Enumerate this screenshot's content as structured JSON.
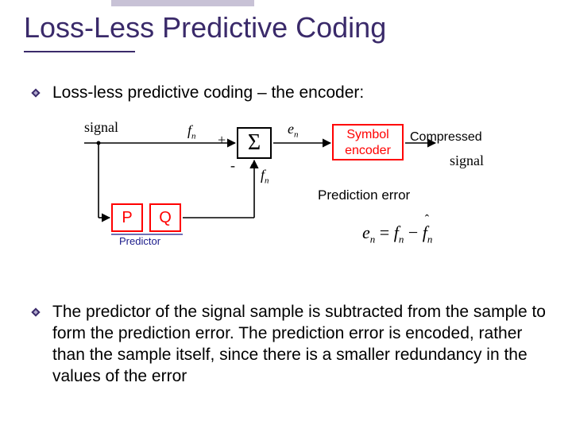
{
  "title": "Loss-Less Predictive Coding",
  "bullets": {
    "first": "Loss-less predictive coding – the encoder:",
    "second": "The predictor of the signal sample is subtracted from the sample to form the prediction error. The prediction error is encoded, rather than the sample itself, since there is a smaller redundancy in the values of the error"
  },
  "diagram": {
    "signal_in": "signal",
    "signal_out": "signal",
    "fn": "f",
    "fn_sub": "n",
    "en": "e",
    "en_sub": "n",
    "fhat": "f",
    "fhat_sub": "n",
    "sigma": "Σ",
    "plus": "+",
    "minus": "-",
    "symbol_encoder_l1": "Symbol",
    "symbol_encoder_l2": "encoder",
    "compressed": "Compressed",
    "p": "P",
    "q": "Q",
    "predictor": "Predictor",
    "prediction_error": "Prediction error",
    "eq_e": "e",
    "eq_e_sub": "n",
    "eq_equals": " = ",
    "eq_f": "f",
    "eq_f_sub": "n",
    "eq_minus": " − ",
    "eq_fhat": "f",
    "eq_fhat_sub": "n"
  }
}
